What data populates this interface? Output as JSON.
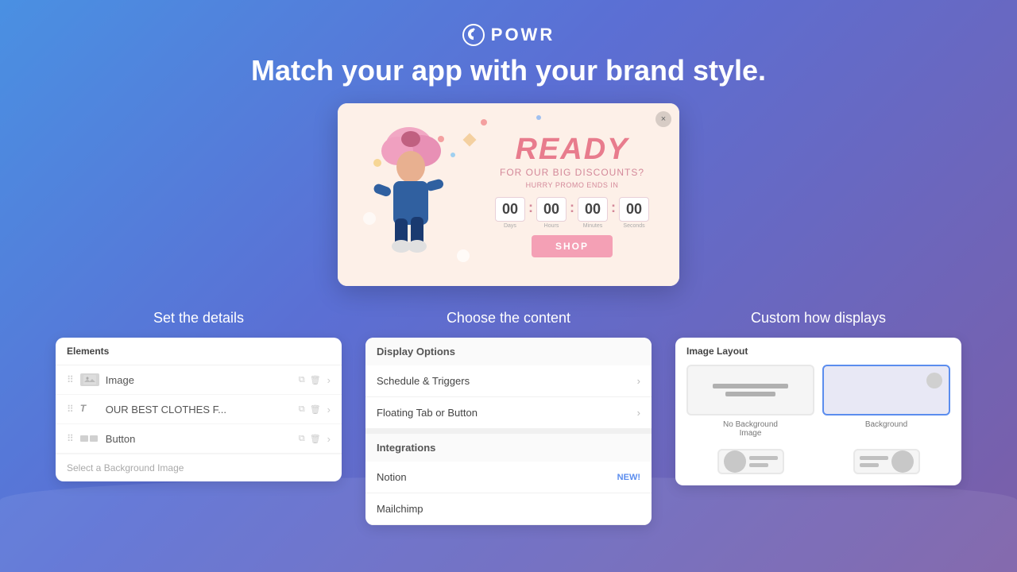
{
  "header": {
    "logo_text": "POWR",
    "tagline": "Match your app with your brand style."
  },
  "preview": {
    "close_label": "×",
    "ready_text": "READY",
    "discount_text": "FOR OUR BIG DISCOUNTS?",
    "promo_text": "HURRY PROMO ENDS IN",
    "countdown": {
      "days_val": "00",
      "hours_val": "00",
      "minutes_val": "00",
      "seconds_val": "00",
      "days_label": "Days",
      "hours_label": "Hours",
      "minutes_label": "Minutes",
      "seconds_label": "Seconds"
    },
    "shop_btn": "SHOP"
  },
  "sections": {
    "left_heading": "Set the details",
    "center_heading": "Choose the content",
    "right_heading": "Custom how displays"
  },
  "elements_panel": {
    "title": "Elements",
    "items": [
      {
        "icon_type": "image",
        "label": "Image"
      },
      {
        "icon_type": "text",
        "label": "OUR BEST CLOTHES F..."
      },
      {
        "icon_type": "button",
        "label": "Button"
      }
    ],
    "bg_label": "Select a Background Image"
  },
  "display_panel": {
    "title": "Display Options",
    "items": [
      {
        "label": "Schedule & Triggers"
      },
      {
        "label": "Floating Tab or Button"
      }
    ],
    "integrations_title": "Integrations",
    "integrations": [
      {
        "label": "Notion",
        "badge": "NEW!"
      },
      {
        "label": "Mailchimp",
        "badge": ""
      }
    ]
  },
  "layout_panel": {
    "title": "Image Layout",
    "options": [
      {
        "label": "No Background\nImage",
        "type": "no-bg"
      },
      {
        "label": "Background",
        "type": "bg"
      }
    ],
    "options_row2": [
      {
        "label": "",
        "type": "left"
      },
      {
        "label": "",
        "type": "right"
      }
    ]
  }
}
